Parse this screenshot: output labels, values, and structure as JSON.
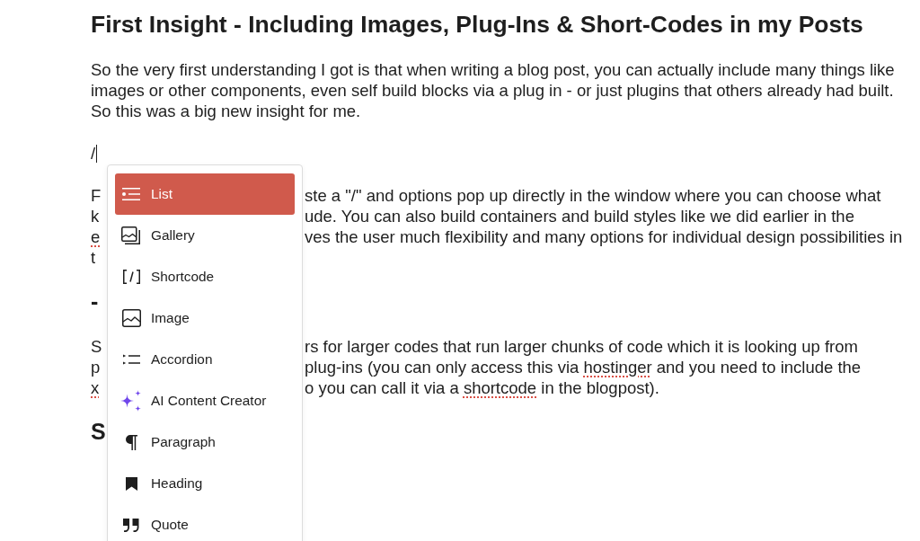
{
  "post": {
    "title": "First Insight - Including Images, Plug-Ins & Short-Codes in my Posts",
    "blocks": [
      {
        "kind": "paragraph",
        "text": "So the very first understanding I got is that when writing a blog post, you can actually include many things like images or other components, even self build blocks via a plug in - or just plugins that others already had built. So this was a big new insight for me."
      },
      {
        "kind": "paragraph",
        "caret": true,
        "text": "/"
      },
      {
        "kind": "paragraph",
        "lines": [
          {
            "start": [
              {
                "text": "F",
                "misspelled": false
              }
            ],
            "end": [
              {
                "text": "ste a \"/\" and options pop up directly in the window where you can choose what",
                "misspelled": false
              }
            ]
          },
          {
            "start": [
              {
                "text": "k",
                "misspelled": false
              }
            ],
            "end": [
              {
                "text": "ude. You can also build containers and build styles like we did earlier in the",
                "misspelled": false
              }
            ]
          },
          {
            "start": [
              {
                "text": "e",
                "misspelled": true
              }
            ],
            "end": [
              {
                "text": "ves the user much flexibility and many options for individual design possibilities in",
                "misspelled": false
              }
            ]
          },
          {
            "start": [
              {
                "text": "t",
                "misspelled": false
              }
            ]
          }
        ]
      },
      {
        "kind": "heading",
        "lines": [
          {
            "start": [
              {
                "text": "-",
                "misspelled": false
              }
            ]
          }
        ]
      },
      {
        "kind": "paragraph",
        "lines": [
          {
            "start": [
              {
                "text": "S",
                "misspelled": false
              }
            ],
            "end": [
              {
                "text": "rs for larger codes that run larger chunks of code which it is looking up from",
                "misspelled": false
              }
            ]
          },
          {
            "start": [
              {
                "text": "p",
                "misspelled": false
              }
            ],
            "end": [
              {
                "text": "plug-ins (you can only access this via ",
                "misspelled": false
              },
              {
                "text": "hostinger",
                "misspelled": true
              },
              {
                "text": " and you need to include the",
                "misspelled": false
              }
            ]
          },
          {
            "start": [
              {
                "text": "x",
                "misspelled": true
              }
            ],
            "end": [
              {
                "text": "o you can call it via a ",
                "misspelled": false
              },
              {
                "text": "shortcode",
                "misspelled": true
              },
              {
                "text": " in the blogpost).",
                "misspelled": false
              }
            ]
          }
        ]
      },
      {
        "kind": "heading",
        "lines": [
          {
            "start": [
              {
                "text": "S",
                "misspelled": false
              }
            ]
          }
        ]
      }
    ]
  },
  "block_inserter": {
    "items": [
      {
        "kind": "list",
        "label": "List",
        "selected": true
      },
      {
        "kind": "gallery",
        "label": "Gallery",
        "selected": false
      },
      {
        "kind": "shortcode",
        "label": "Shortcode",
        "selected": false
      },
      {
        "kind": "image",
        "label": "Image",
        "selected": false
      },
      {
        "kind": "accordion",
        "label": "Accordion",
        "selected": false
      },
      {
        "kind": "ai",
        "label": "AI Content Creator",
        "selected": false
      },
      {
        "kind": "paragraph",
        "label": "Paragraph",
        "selected": false
      },
      {
        "kind": "heading",
        "label": "Heading",
        "selected": false
      },
      {
        "kind": "quote",
        "label": "Quote",
        "selected": false
      }
    ]
  }
}
